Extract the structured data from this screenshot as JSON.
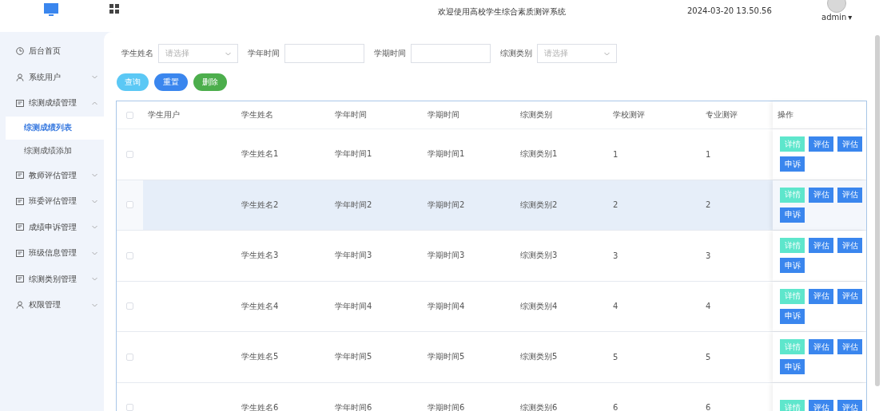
{
  "header": {
    "title": "欢迎使用高校学生综合素质测评系统",
    "datetime": "2024-03-20 13.50.56",
    "user": "admin",
    "caret": "▾"
  },
  "sidebar": {
    "items": [
      {
        "label": "后台首页",
        "kind": "dashboard"
      },
      {
        "label": "系统用户",
        "kind": "account",
        "expanded": false
      },
      {
        "label": "综测成绩管理",
        "kind": "module",
        "expanded": true,
        "children": [
          {
            "label": "综测成绩列表",
            "selected": true
          },
          {
            "label": "综测成绩添加",
            "selected": false
          }
        ]
      },
      {
        "label": "教师评估管理",
        "kind": "module",
        "expanded": false
      },
      {
        "label": "班委评估管理",
        "kind": "module",
        "expanded": false
      },
      {
        "label": "成绩申诉管理",
        "kind": "module",
        "expanded": false
      },
      {
        "label": "班级信息管理",
        "kind": "module",
        "expanded": false
      },
      {
        "label": "综测类别管理",
        "kind": "module",
        "expanded": false
      },
      {
        "label": "权限管理",
        "kind": "account",
        "expanded": false
      }
    ]
  },
  "filters": [
    {
      "label": "学生姓名",
      "kind": "select",
      "placeholder": "请选择"
    },
    {
      "label": "学年时间",
      "kind": "input"
    },
    {
      "label": "学期时间",
      "kind": "input"
    },
    {
      "label": "综测类别",
      "kind": "select",
      "placeholder": "请选择"
    }
  ],
  "buttons": [
    {
      "label": "查询",
      "kind": "search"
    },
    {
      "label": "重置",
      "kind": "reset"
    },
    {
      "label": "删除",
      "kind": "delete"
    }
  ],
  "table": {
    "columns": [
      "学生用户",
      "学生姓名",
      "学年时间",
      "学期时间",
      "综测类别",
      "学校测评",
      "专业测评",
      "操作"
    ],
    "header_checked": false,
    "rows": [
      {
        "checked": false,
        "highlighted": false,
        "cells": [
          "",
          "学生姓名1",
          "学年时间1",
          "学期时间1",
          "综测类别1",
          "1",
          "1"
        ],
        "actions": [
          {
            "label": "详情",
            "kind": "detail"
          },
          {
            "label": "评估",
            "kind": "primary"
          },
          {
            "label": "评估",
            "kind": "primary"
          },
          {
            "label": "申诉",
            "kind": "primary"
          }
        ]
      },
      {
        "checked": false,
        "highlighted": true,
        "cells": [
          "",
          "学生姓名2",
          "学年时间2",
          "学期时间2",
          "综测类别2",
          "2",
          "2"
        ],
        "actions": [
          {
            "label": "详情",
            "kind": "detail"
          },
          {
            "label": "评估",
            "kind": "primary"
          },
          {
            "label": "评估",
            "kind": "primary"
          },
          {
            "label": "申诉",
            "kind": "primary"
          }
        ]
      },
      {
        "checked": false,
        "highlighted": false,
        "cells": [
          "",
          "学生姓名3",
          "学年时间3",
          "学期时间3",
          "综测类别3",
          "3",
          "3"
        ],
        "actions": [
          {
            "label": "详情",
            "kind": "detail"
          },
          {
            "label": "评估",
            "kind": "primary"
          },
          {
            "label": "评估",
            "kind": "primary"
          },
          {
            "label": "申诉",
            "kind": "primary"
          }
        ]
      },
      {
        "checked": false,
        "highlighted": false,
        "cells": [
          "",
          "学生姓名4",
          "学年时间4",
          "学期时间4",
          "综测类别4",
          "4",
          "4"
        ],
        "actions": [
          {
            "label": "详情",
            "kind": "detail"
          },
          {
            "label": "评估",
            "kind": "primary"
          },
          {
            "label": "评估",
            "kind": "primary"
          },
          {
            "label": "申诉",
            "kind": "primary"
          }
        ]
      },
      {
        "checked": false,
        "highlighted": false,
        "cells": [
          "",
          "学生姓名5",
          "学年时间5",
          "学期时间5",
          "综测类别5",
          "5",
          "5"
        ],
        "actions": [
          {
            "label": "详情",
            "kind": "detail"
          },
          {
            "label": "评估",
            "kind": "primary"
          },
          {
            "label": "评估",
            "kind": "primary"
          },
          {
            "label": "申诉",
            "kind": "primary"
          }
        ]
      },
      {
        "checked": false,
        "highlighted": false,
        "cells": [
          "",
          "学生姓名6",
          "学年时间6",
          "学期时间6",
          "综测类别6",
          "6",
          "6"
        ],
        "actions": [
          {
            "label": "详情",
            "kind": "detail"
          },
          {
            "label": "评估",
            "kind": "primary"
          },
          {
            "label": "评估",
            "kind": "primary"
          }
        ]
      }
    ]
  }
}
